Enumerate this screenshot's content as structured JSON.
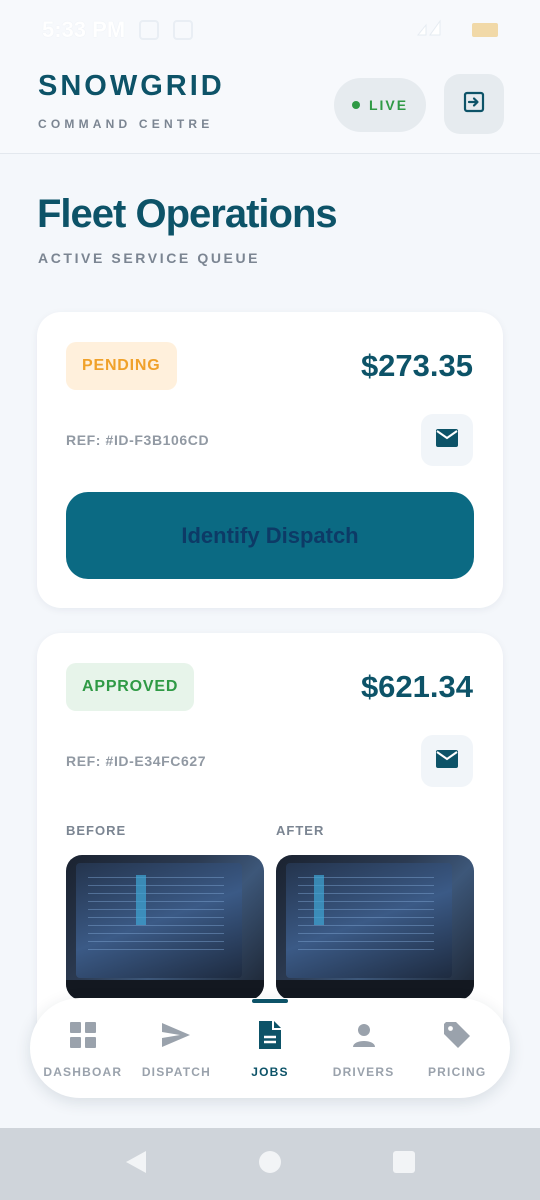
{
  "status_bar": {
    "time": "5:33 PM"
  },
  "header": {
    "brand_title": "SNOWGRID",
    "brand_subtitle": "COMMAND CENTRE",
    "live_label": "LIVE",
    "icons": {
      "exit": "exit-icon"
    }
  },
  "page": {
    "title": "Fleet Operations",
    "subtitle": "ACTIVE SERVICE QUEUE"
  },
  "jobs": [
    {
      "status": "PENDING",
      "amount": "$273.35",
      "ref": "REF: #ID-F3B106CD",
      "action_label": "Identify Dispatch"
    },
    {
      "status": "APPROVED",
      "amount": "$621.34",
      "ref": "REF: #ID-E34FC627",
      "before_label": "BEFORE",
      "after_label": "AFTER"
    }
  ],
  "bottom_nav": [
    {
      "label": "DASHBOAR",
      "icon": "grid-icon"
    },
    {
      "label": "DISPATCH",
      "icon": "send-icon"
    },
    {
      "label": "JOBS",
      "icon": "document-icon",
      "active": true
    },
    {
      "label": "DRIVERS",
      "icon": "person-icon"
    },
    {
      "label": "PRICING",
      "icon": "tag-icon"
    }
  ],
  "colors": {
    "primary": "#0d5368",
    "pending": "#f0a12a",
    "approved": "#2f9a45",
    "button": "#0b6a83"
  }
}
